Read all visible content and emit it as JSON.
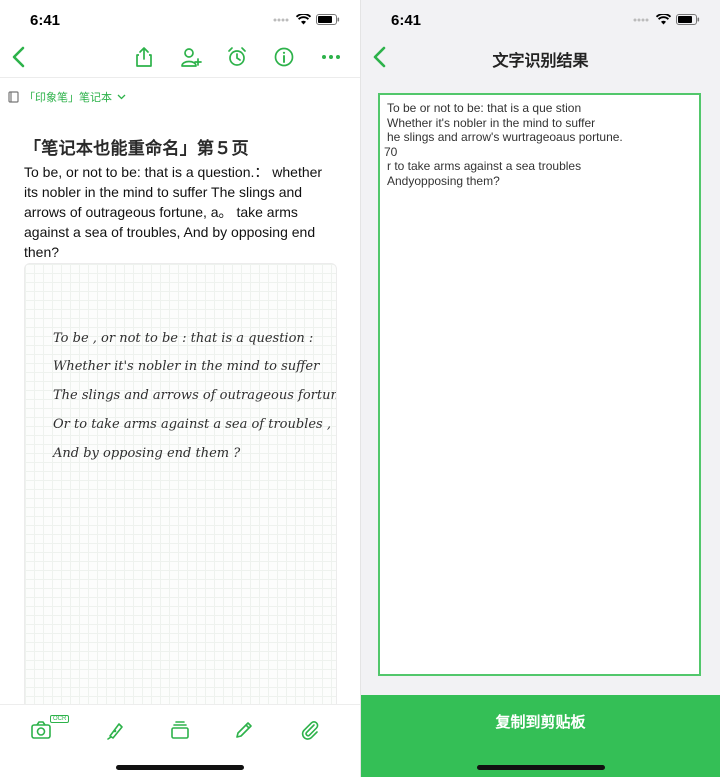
{
  "status_bar": {
    "time": "6:41"
  },
  "note_screen": {
    "notebook": {
      "name": "「印象笔」笔记本"
    },
    "note": {
      "title": "「笔记本也能重命名」第５页",
      "body": "To be, or not to be: that is a question.： whether its nobler in the mind to suffer The slings and arrows of outrageous fortune, a。 take arms against a sea of troubles, And by opposing end then?",
      "handwriting": [
        "To be , or not to be : that is a question :",
        "Whether it's nobler in the mind to suffer",
        "The slings and arrows of outrageous fortune .",
        "Or to take arms against a sea of troubles ,",
        "And by opposing end them ?"
      ]
    },
    "bottom_toolbar": {
      "ocr_badge": "OCR"
    }
  },
  "ocr_screen": {
    "title": "文字识别结果",
    "lines": [
      "To be or not to be: that is a que stion",
      "Whether it's nobler in the mind to suffer",
      "he slings and arrow's wurtrageoaus portune.",
      "70",
      "r to take arms against a sea troubles",
      "Andyopposing them?"
    ],
    "copy_button": "复制到剪贴板"
  },
  "colors": {
    "accent": "#2db24a",
    "copy_bar": "#34bf56",
    "ocr_border": "#52c76b"
  }
}
